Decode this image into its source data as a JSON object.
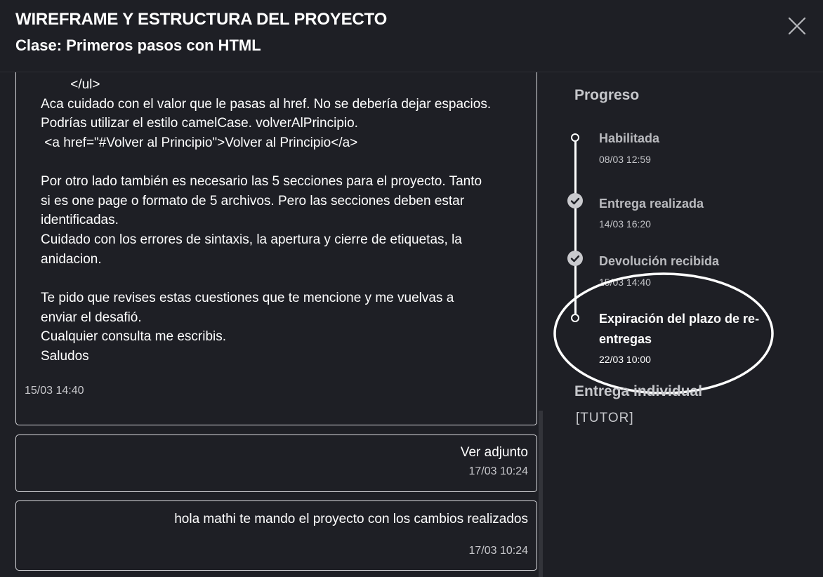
{
  "header": {
    "title": "WIREFRAME Y ESTRUCTURA DEL PROYECTO",
    "subtitle": "Clase: Primeros pasos con HTML",
    "close_icon": "close-icon"
  },
  "messages": [
    {
      "lines": [
        "        </ul>",
        "Aca cuidado con el valor que le pasas al href. No se debería dejar espacios.",
        "Podrías utilizar el estilo camelCase. volverAlPrincipio.",
        " <a href=\"#Volver al Principio\">Volver al Principio</a>",
        "",
        "Por otro lado también es necesario las 5 secciones para el proyecto. Tanto",
        "si es one page o formato de 5 archivos. Pero las secciones deben estar",
        "identificadas.",
        "Cuidado con los errores de sintaxis, la apertura y cierre de etiquetas, la",
        "anidacion.",
        "",
        "Te pido que revises estas cuestiones que te mencione y me vuelvas a",
        "enviar el desafió.",
        "Cualquier consulta me escribis.",
        "Saludos"
      ],
      "time": "15/03 14:40"
    },
    {
      "text": "Ver adjunto",
      "time": "17/03 10:24"
    },
    {
      "text": "hola mathi te mando el proyecto con los cambios realizados",
      "time": "17/03 10:24"
    }
  ],
  "progress": {
    "title": "Progreso",
    "steps": [
      {
        "label": "Habilitada",
        "date": "08/03 12:59",
        "icon": "circle-icon"
      },
      {
        "label": "Entrega realizada",
        "date": "14/03 16:20",
        "icon": "check-circle-icon"
      },
      {
        "label": "Devolución recibida",
        "date": "15/03 14:40",
        "icon": "check-circle-icon"
      },
      {
        "label": "Expiración del plazo de re-entregas",
        "date": "22/03 10:00",
        "icon": "circle-icon"
      }
    ]
  },
  "submission": {
    "title": "Entrega individual",
    "role": "[TUTOR]"
  },
  "colors": {
    "background": "#1e1f25",
    "text": "#ffffff",
    "muted": "#c6c7cb",
    "border": "#d8d8dc"
  }
}
